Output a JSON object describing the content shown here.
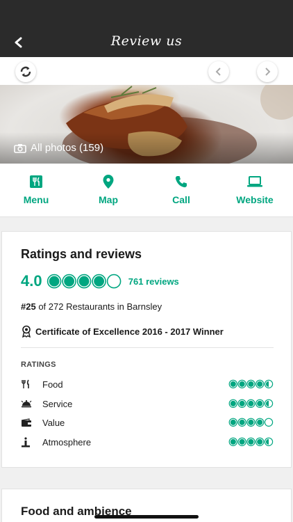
{
  "header": {
    "title": "Review us"
  },
  "photos": {
    "label": "All photos (159)"
  },
  "actions": [
    {
      "label": "Menu",
      "icon": "fork-knife-icon"
    },
    {
      "label": "Map",
      "icon": "map-pin-icon"
    },
    {
      "label": "Call",
      "icon": "phone-icon"
    },
    {
      "label": "Website",
      "icon": "laptop-icon"
    }
  ],
  "ratings_card": {
    "title": "Ratings and reviews",
    "score": "4.0",
    "score_value": 4.0,
    "reviews_link": "761 reviews",
    "rank_number": "#25",
    "rank_text": " of 272 Restaurants in Barnsley",
    "certificate": "Certificate of Excellence 2016 - 2017 Winner",
    "ratings_heading": "RATINGS",
    "ratings": [
      {
        "name": "Food",
        "value": 4.5,
        "icon": "fork-knife-icon"
      },
      {
        "name": "Service",
        "value": 4.5,
        "icon": "service-bell-icon"
      },
      {
        "name": "Value",
        "value": 4.0,
        "icon": "wallet-icon"
      },
      {
        "name": "Atmosphere",
        "value": 4.5,
        "icon": "atmosphere-icon"
      }
    ]
  },
  "food_card": {
    "title": "Food and ambience"
  },
  "colors": {
    "accent": "#00a680",
    "header_bg": "#2b2b2b"
  }
}
